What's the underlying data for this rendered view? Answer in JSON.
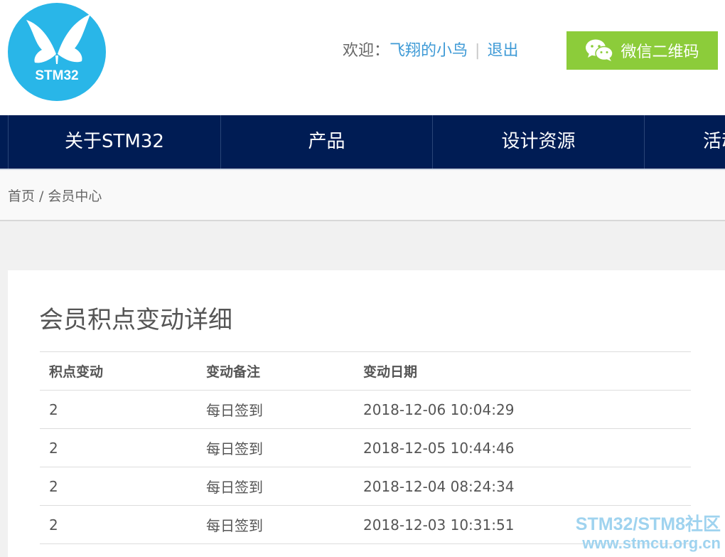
{
  "header": {
    "logo_text": "STM32",
    "welcome_label": "欢迎：",
    "username": "飞翔的小鸟",
    "separator": "|",
    "logout_label": "退出",
    "wechat_button_label": "微信二维码"
  },
  "nav": {
    "items": [
      {
        "label": "关于STM32"
      },
      {
        "label": "产品"
      },
      {
        "label": "设计资源"
      },
      {
        "label": "活动"
      }
    ]
  },
  "breadcrumb": {
    "home": "首页",
    "separator": "/",
    "current": "会员中心"
  },
  "main": {
    "title": "会员积点变动详细",
    "table": {
      "headers": [
        "积点变动",
        "变动备注",
        "变动日期"
      ],
      "rows": [
        [
          "2",
          "每日签到",
          "2018-12-06 10:04:29"
        ],
        [
          "2",
          "每日签到",
          "2018-12-05 10:44:46"
        ],
        [
          "2",
          "每日签到",
          "2018-12-04 08:24:34"
        ],
        [
          "2",
          "每日签到",
          "2018-12-03 10:31:51"
        ]
      ]
    }
  },
  "watermark": {
    "line1": "STM32/STM8社区",
    "line2": "www.stmcu.org.cn"
  },
  "colors": {
    "nav_bg": "#001c54",
    "link": "#3e9ad6",
    "wechat_green": "#8ccc3a",
    "logo_blue": "#29b6e8",
    "watermark": "#9fd3ef"
  },
  "icons": {
    "logo": "butterfly-icon",
    "wechat": "wechat-icon"
  }
}
